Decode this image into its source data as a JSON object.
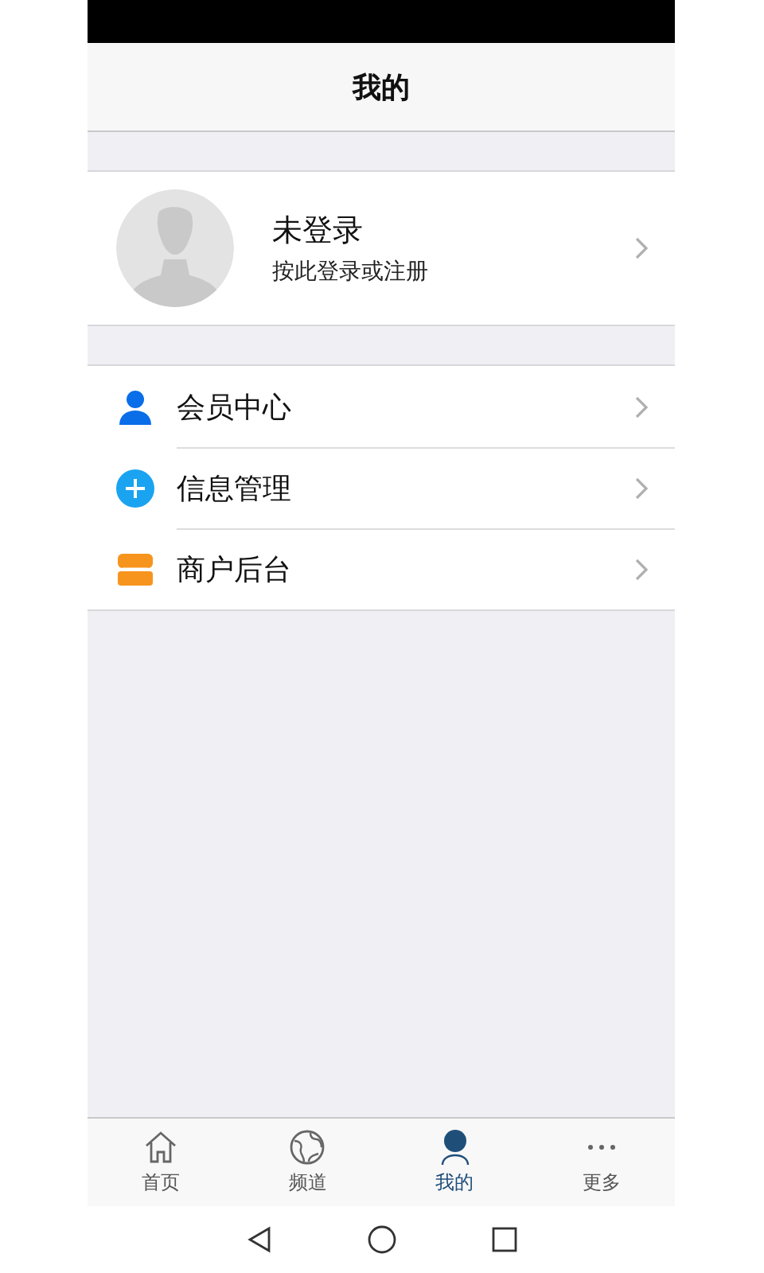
{
  "header": {
    "title": "我的"
  },
  "profile": {
    "name": "未登录",
    "hint": "按此登录或注册"
  },
  "menu": [
    {
      "kind": "member",
      "label": "会员中心"
    },
    {
      "kind": "info",
      "label": "信息管理"
    },
    {
      "kind": "shop",
      "label": "商户后台"
    }
  ],
  "tabs": [
    {
      "kind": "home",
      "label": "首页",
      "selected": false
    },
    {
      "kind": "channel",
      "label": "频道",
      "selected": false
    },
    {
      "kind": "mine",
      "label": "我的",
      "selected": true
    },
    {
      "kind": "more",
      "label": "更多",
      "selected": false
    }
  ]
}
